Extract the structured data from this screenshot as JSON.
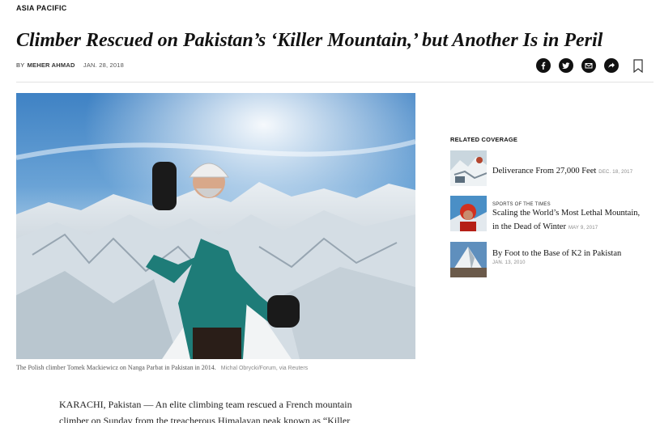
{
  "section": {
    "label": "ASIA PACIFIC"
  },
  "article": {
    "headline": "Climber Rescued on Pakistan’s ‘Killer Mountain,’ but Another Is in Peril",
    "byline_prefix": "By",
    "author": "MEHER AHMAD",
    "date": "JAN. 28, 2018",
    "body_lines": [
      "KARACHI, Pakistan — An elite climbing team rescued a French mountain",
      "climber on Sunday from the treacherous Himalayan peak known as “Killer"
    ]
  },
  "share": {
    "icons": [
      "facebook-icon",
      "twitter-icon",
      "email-icon",
      "share-arrow-icon",
      "bookmark-icon"
    ]
  },
  "hero": {
    "caption": "The Polish climber Tomek Mackiewicz on Nanga Parbat in Pakistan in 2014.",
    "credit": "Michal Obrycki/Forum, via Reuters"
  },
  "related": {
    "title": "RELATED COVERAGE",
    "items": [
      {
        "kicker": "",
        "headline": "Deliverance From 27,000 Feet",
        "date": "DEC. 18, 2017"
      },
      {
        "kicker": "SPORTS OF THE TIMES",
        "headline_line1": "Scaling the World’s Most Lethal Mountain,",
        "headline_line2": "in the Dead of Winter",
        "date": "MAY 9, 2017"
      },
      {
        "kicker": "",
        "headline": "By Foot to the Base of K2 in Pakistan",
        "date": "JAN. 13, 2010"
      }
    ]
  },
  "colors": {
    "text": "#121212",
    "muted": "#888888",
    "divider": "#e2e2e2",
    "icon_bg": "#111111"
  }
}
